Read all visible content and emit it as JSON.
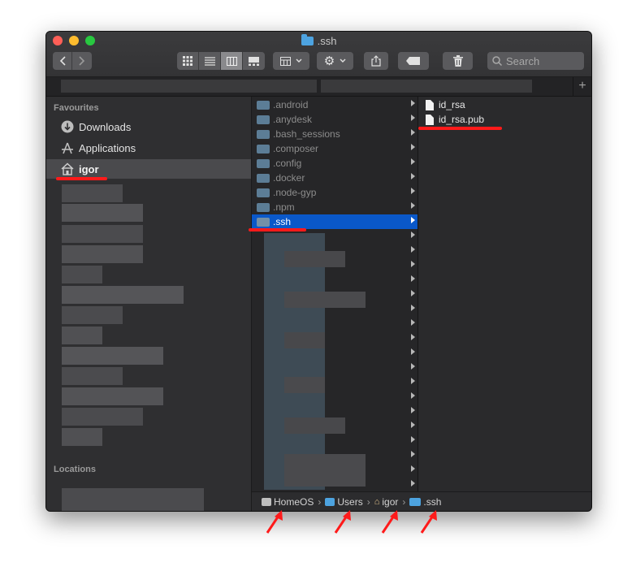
{
  "window": {
    "title": ".ssh",
    "search_placeholder": "Search"
  },
  "sidebar": {
    "favourites_header": "Favourites",
    "items": [
      {
        "label": "Downloads",
        "icon": "download-icon"
      },
      {
        "label": "Applications",
        "icon": "applications-icon"
      },
      {
        "label": "igor",
        "icon": "home-icon"
      }
    ],
    "locations_header": "Locations"
  },
  "column_folders": [
    ".android",
    ".anydesk",
    ".bash_sessions",
    ".composer",
    ".config",
    ".docker",
    ".node-gyp",
    ".npm",
    ".ssh"
  ],
  "column_files": [
    "id_rsa",
    "id_rsa.pub"
  ],
  "path": [
    "HomeOS",
    "Users",
    "igor",
    ".ssh"
  ],
  "colors": {
    "selection": "#0a58c9",
    "folder_blue": "#4da3e0",
    "annotation_red": "#ff1a1a"
  }
}
